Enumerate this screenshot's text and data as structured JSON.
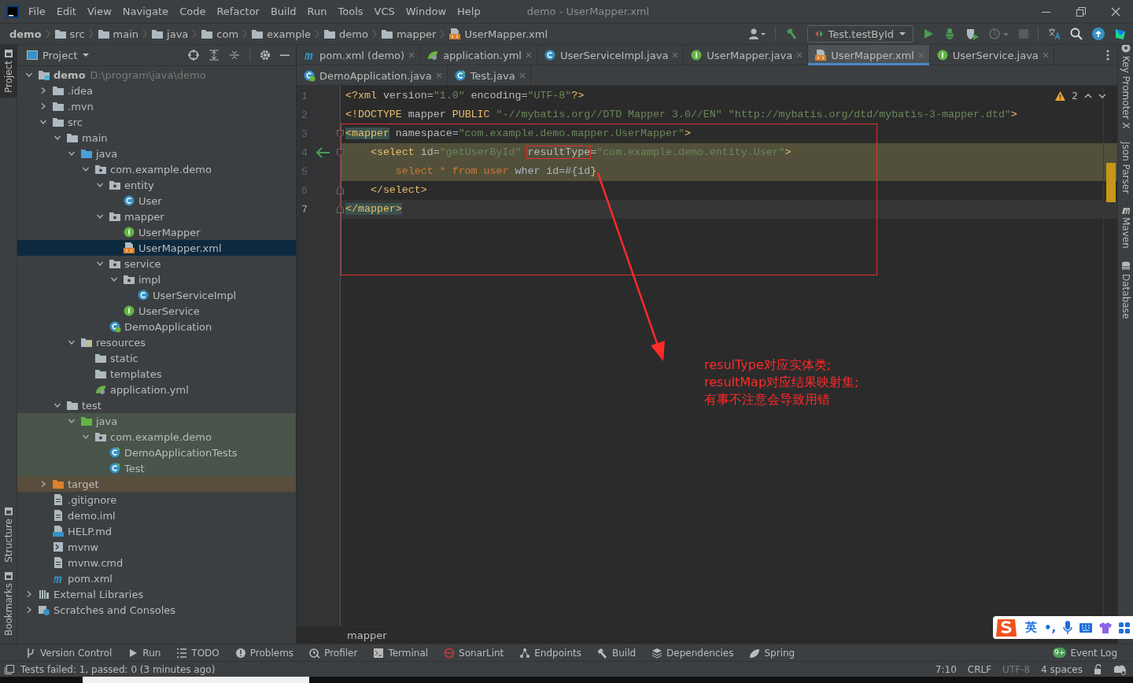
{
  "menu_bar": {
    "items": [
      "File",
      "Edit",
      "View",
      "Navigate",
      "Code",
      "Refactor",
      "Build",
      "Run",
      "Tools",
      "VCS",
      "Window",
      "Help"
    ],
    "title": "demo - UserMapper.xml"
  },
  "breadcrumbs": [
    {
      "label": "demo",
      "kind": "project"
    },
    {
      "label": "src",
      "kind": "folder"
    },
    {
      "label": "main",
      "kind": "folder"
    },
    {
      "label": "java",
      "kind": "folder"
    },
    {
      "label": "com",
      "kind": "folder"
    },
    {
      "label": "example",
      "kind": "folder"
    },
    {
      "label": "demo",
      "kind": "folder"
    },
    {
      "label": "mapper",
      "kind": "folder"
    },
    {
      "label": "UserMapper.xml",
      "kind": "xml"
    }
  ],
  "toolbar": {
    "run_config": "Test.testById"
  },
  "left_tool_windows": {
    "top": [
      {
        "label": "Project",
        "selected": true
      }
    ],
    "bottom": [
      {
        "label": "Structure",
        "selected": false
      },
      {
        "label": "Bookmarks",
        "selected": false
      }
    ]
  },
  "project": {
    "title": "Project",
    "tree": [
      {
        "label": "demo",
        "hint": "D:\\program\\java\\demo",
        "kind": "module",
        "expanded": true,
        "selected": false,
        "children": [
          {
            "label": ".idea",
            "kind": "folder",
            "expanded": false,
            "selected": false
          },
          {
            "label": ".mvn",
            "kind": "folder",
            "expanded": false,
            "selected": false
          },
          {
            "label": "src",
            "kind": "folder",
            "expanded": true,
            "selected": false,
            "children": [
              {
                "label": "main",
                "kind": "folder",
                "expanded": true,
                "selected": false,
                "children": [
                  {
                    "label": "java",
                    "kind": "source",
                    "expanded": true,
                    "selected": false,
                    "children": [
                      {
                        "label": "com.example.demo",
                        "kind": "package",
                        "expanded": true,
                        "selected": false,
                        "children": [
                          {
                            "label": "entity",
                            "kind": "package",
                            "expanded": true,
                            "selected": false,
                            "children": [
                              {
                                "label": "User",
                                "kind": "class",
                                "selected": false
                              }
                            ]
                          },
                          {
                            "label": "mapper",
                            "kind": "package",
                            "expanded": true,
                            "selected": false,
                            "children": [
                              {
                                "label": "UserMapper",
                                "kind": "interface",
                                "selected": false
                              },
                              {
                                "label": "UserMapper.xml",
                                "kind": "xml",
                                "selected": true
                              }
                            ]
                          },
                          {
                            "label": "service",
                            "kind": "package",
                            "expanded": true,
                            "selected": false,
                            "children": [
                              {
                                "label": "impl",
                                "kind": "package",
                                "expanded": true,
                                "selected": false,
                                "children": [
                                  {
                                    "label": "UserServiceImpl",
                                    "kind": "class",
                                    "selected": false
                                  }
                                ]
                              },
                              {
                                "label": "UserService",
                                "kind": "interface",
                                "selected": false
                              }
                            ]
                          },
                          {
                            "label": "DemoApplication",
                            "kind": "spring",
                            "selected": false
                          }
                        ]
                      }
                    ]
                  },
                  {
                    "label": "resources",
                    "kind": "resources",
                    "expanded": true,
                    "selected": false,
                    "children": [
                      {
                        "label": "static",
                        "kind": "folder",
                        "selected": false
                      },
                      {
                        "label": "templates",
                        "kind": "folder",
                        "selected": false
                      },
                      {
                        "label": "application.yml",
                        "kind": "yaml",
                        "selected": false
                      }
                    ]
                  }
                ]
              },
              {
                "label": "test",
                "kind": "folder",
                "expanded": true,
                "selected": false,
                "children": [
                  {
                    "label": "java",
                    "kind": "test-source",
                    "expanded": true,
                    "selected": false,
                    "color": "#49544a",
                    "children": [
                      {
                        "label": "com.example.demo",
                        "kind": "package",
                        "expanded": true,
                        "selected": false,
                        "color": "#49544a",
                        "children": [
                          {
                            "label": "DemoApplicationTests",
                            "kind": "test-class",
                            "selected": false,
                            "color": "#49544a"
                          },
                          {
                            "label": "Test",
                            "kind": "test-class",
                            "selected": false,
                            "color": "#49544a"
                          }
                        ]
                      }
                    ]
                  }
                ]
              }
            ]
          },
          {
            "label": "target",
            "kind": "excluded",
            "expanded": false,
            "selected": false,
            "color": "#594d3c"
          },
          {
            "label": ".gitignore",
            "kind": "file",
            "selected": false
          },
          {
            "label": "demo.iml",
            "kind": "file",
            "selected": false
          },
          {
            "label": "HELP.md",
            "kind": "markdown",
            "selected": false
          },
          {
            "label": "mvnw",
            "kind": "script",
            "selected": false
          },
          {
            "label": "mvnw.cmd",
            "kind": "file",
            "selected": false
          },
          {
            "label": "pom.xml",
            "kind": "maven",
            "selected": false
          }
        ]
      },
      {
        "label": "External Libraries",
        "kind": "libraries",
        "expanded": false,
        "selected": false
      },
      {
        "label": "Scratches and Consoles",
        "kind": "scratches",
        "expanded": false,
        "selected": false
      }
    ]
  },
  "editor": {
    "tab_rows": [
      {
        "tabs": [
          {
            "label": "pom.xml (demo)",
            "kind": "maven",
            "selected": false
          },
          {
            "label": "application.yml",
            "kind": "yaml",
            "selected": false
          },
          {
            "label": "UserServiceImpl.java",
            "kind": "class",
            "selected": false
          },
          {
            "label": "UserMapper.java",
            "kind": "interface",
            "selected": false
          },
          {
            "label": "UserMapper.xml",
            "kind": "xml",
            "selected": true
          },
          {
            "label": "UserService.java",
            "kind": "interface",
            "selected": false
          }
        ]
      },
      {
        "tabs": [
          {
            "label": "DemoApplication.java",
            "kind": "spring",
            "selected": false
          },
          {
            "label": "Test.java",
            "kind": "test-class",
            "selected": false
          }
        ]
      }
    ],
    "warnings": "2",
    "lines": [
      {
        "number": "1",
        "highlighted": false,
        "current": false,
        "fold_start": false,
        "fold_end": false,
        "gutter_marker": false,
        "tokens": [
          {
            "kind": "tag",
            "text": "<?xml"
          },
          {
            "kind": "attr",
            "text": " version"
          },
          {
            "kind": "plain",
            "text": "="
          },
          {
            "kind": "string",
            "text": "\"1.0\""
          },
          {
            "kind": "attr",
            "text": " encoding"
          },
          {
            "kind": "plain",
            "text": "="
          },
          {
            "kind": "string",
            "text": "\"UTF-8\""
          },
          {
            "kind": "tag",
            "text": "?>"
          }
        ]
      },
      {
        "number": "2",
        "highlighted": false,
        "current": false,
        "fold_start": false,
        "fold_end": false,
        "gutter_marker": false,
        "tokens": [
          {
            "kind": "tag",
            "text": "<!DOCTYPE"
          },
          {
            "kind": "attr",
            "text": " mapper"
          },
          {
            "kind": "tag",
            "text": " PUBLIC"
          },
          {
            "kind": "string",
            "text": " \"-//mybatis.org//DTD Mapper 3.0//EN\""
          },
          {
            "kind": "string",
            "text": " \"http://mybatis.org/dtd/mybatis-3-mapper.dtd\""
          },
          {
            "kind": "tag",
            "text": ">"
          }
        ]
      },
      {
        "number": "3",
        "highlighted": false,
        "current": false,
        "fold_start": true,
        "fold_end": false,
        "gutter_marker": false,
        "tokens": [
          {
            "kind": "match",
            "text": "<mapper"
          },
          {
            "kind": "attr",
            "text": " namespace"
          },
          {
            "kind": "plain",
            "text": "="
          },
          {
            "kind": "string",
            "text": "\"com.example.demo.mapper.UserMapper\""
          },
          {
            "kind": "tag",
            "text": ">"
          }
        ]
      },
      {
        "number": "4",
        "highlighted": true,
        "current": false,
        "fold_start": true,
        "fold_end": false,
        "gutter_marker": true,
        "tokens": [
          {
            "kind": "tag",
            "text": "    <select"
          },
          {
            "kind": "attr",
            "text": " id"
          },
          {
            "kind": "plain",
            "text": "="
          },
          {
            "kind": "string",
            "text": "\"getUserById\" "
          },
          {
            "kind": "boxed",
            "text": "resultType"
          },
          {
            "kind": "plain",
            "text": "="
          },
          {
            "kind": "string",
            "text": "\"com.example.demo.entity.User\""
          },
          {
            "kind": "tag",
            "text": ">"
          }
        ]
      },
      {
        "number": "5",
        "highlighted": true,
        "current": false,
        "fold_start": false,
        "fold_end": false,
        "gutter_marker": false,
        "tokens": [
          {
            "kind": "sql",
            "text": "        select * from user"
          },
          {
            "kind": "plain",
            "text": " wher id=#{id"
          },
          {
            "kind": "tag",
            "text": "}"
          }
        ]
      },
      {
        "number": "6",
        "highlighted": false,
        "current": false,
        "fold_start": false,
        "fold_end": true,
        "gutter_marker": false,
        "tokens": [
          {
            "kind": "tag",
            "text": "    </select>"
          }
        ]
      },
      {
        "number": "7",
        "highlighted": false,
        "current": true,
        "fold_start": false,
        "fold_end": true,
        "gutter_marker": false,
        "tokens": [
          {
            "kind": "match",
            "text": "</mapper>"
          }
        ]
      }
    ],
    "breadcrumb": "mapper",
    "annotation": {
      "lines": [
        "resulType对应实体类;",
        "resultMap对应结果映射集;",
        "有事不注意会导致用错"
      ]
    }
  },
  "right_tool_windows": [
    {
      "label": "Key Promoter X",
      "kind": "key"
    },
    {
      "label": "Json Parser",
      "kind": "none"
    },
    {
      "label": "Maven",
      "kind": "maven"
    },
    {
      "label": "Database",
      "kind": "database"
    }
  ],
  "tool_windows_bar": {
    "items": [
      {
        "label": "Version Control",
        "kind": "vcs"
      },
      {
        "label": "Run",
        "kind": "run"
      },
      {
        "label": "TODO",
        "kind": "todo"
      },
      {
        "label": "Problems",
        "kind": "problems"
      },
      {
        "label": "Profiler",
        "kind": "profiler"
      },
      {
        "label": "Terminal",
        "kind": "terminal"
      },
      {
        "label": "SonarLint",
        "kind": "sonar"
      },
      {
        "label": "Endpoints",
        "kind": "endpoints"
      },
      {
        "label": "Build",
        "kind": "build"
      },
      {
        "label": "Dependencies",
        "kind": "dependencies"
      },
      {
        "label": "Spring",
        "kind": "spring"
      }
    ],
    "event_log": {
      "label": "Event Log",
      "badge": "9+"
    }
  },
  "status_bar": {
    "message": "Tests failed: 1, passed: 0 (3 minutes ago)",
    "position": "7:10",
    "line_separator": "CRLF",
    "encoding": "UTF-8",
    "indent": "4 spaces"
  },
  "ime": {
    "mode": "英",
    "punctuation": "•,"
  }
}
